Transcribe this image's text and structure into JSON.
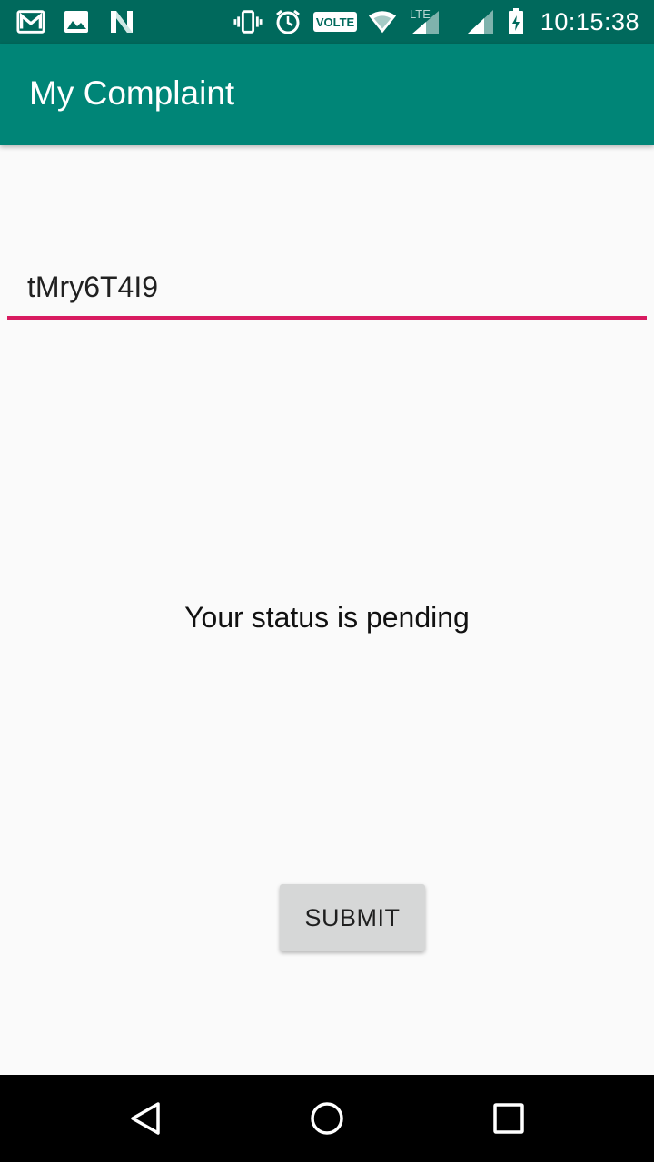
{
  "status_bar": {
    "time": "10:15:38",
    "volte_label": "VOLTE",
    "lte_label": "LTE",
    "left_icons": [
      "gmail-icon",
      "gallery-icon",
      "n-notification-icon"
    ],
    "right_icons": [
      "vibrate-icon",
      "alarm-icon",
      "volte-icon",
      "wifi-icon",
      "signal-lte-icon",
      "signal-icon",
      "battery-charging-icon"
    ],
    "background_color": "#00695c"
  },
  "app_bar": {
    "title": "My Complaint",
    "color": "#008577"
  },
  "complaint_input": {
    "value": "tMry6T4I9",
    "underline_color": "#d81b60"
  },
  "status_message": "Your status is pending",
  "submit_button": {
    "label": "SUBMIT"
  },
  "nav_bar": {
    "buttons": [
      "back-icon",
      "home-icon",
      "recents-icon"
    ]
  }
}
